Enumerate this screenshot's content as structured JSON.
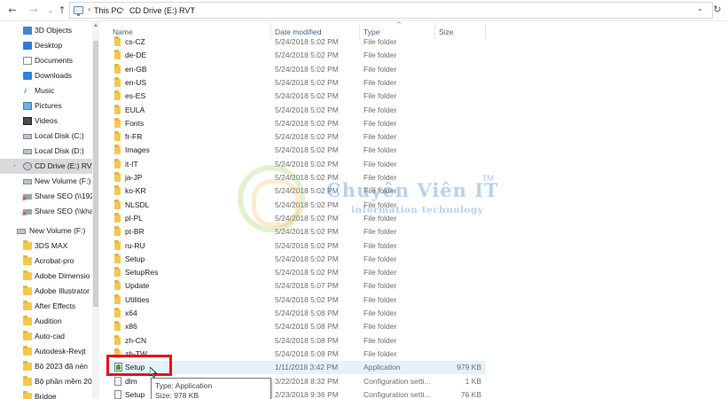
{
  "addressbar": {
    "back_icon": "←",
    "forward_icon": "→",
    "history_icon": "⌄",
    "up_icon": "↑",
    "crumbs": [
      "This PC",
      "CD Drive (E:) RVT"
    ],
    "sep_icon": "›",
    "dropdown_icon": "⌄",
    "refresh_icon": "↻"
  },
  "navpane": {
    "items": [
      {
        "label": "3D Objects",
        "icon": "3d-objects-icon"
      },
      {
        "label": "Desktop",
        "icon": "desktop-icon"
      },
      {
        "label": "Documents",
        "icon": "documents-icon"
      },
      {
        "label": "Downloads",
        "icon": "downloads-icon"
      },
      {
        "label": "Music",
        "icon": "music-icon"
      },
      {
        "label": "Pictures",
        "icon": "pictures-icon"
      },
      {
        "label": "Videos",
        "icon": "videos-icon"
      },
      {
        "label": "Local Disk (C:)",
        "icon": "drive-icon"
      },
      {
        "label": "Local Disk (D:)",
        "icon": "drive-icon"
      },
      {
        "label": "CD Drive (E:) RVT",
        "icon": "cd-drive-icon"
      },
      {
        "label": "New Volume (F:)",
        "icon": "drive-icon"
      },
      {
        "label": "Share SEO (\\\\192",
        "icon": "network-drive-icon"
      },
      {
        "label": "Share SEO (\\\\kha",
        "icon": "network-drive-icon"
      },
      {
        "label": "New Volume (F:)",
        "icon": "drive-icon"
      },
      {
        "label": "3DS MAX",
        "icon": "folder-icon"
      },
      {
        "label": "Acrobat-pro",
        "icon": "folder-icon"
      },
      {
        "label": "Adobe Dimensio",
        "icon": "folder-icon"
      },
      {
        "label": "Adobe Illustrator",
        "icon": "folder-icon"
      },
      {
        "label": "After Effects",
        "icon": "folder-icon"
      },
      {
        "label": "Audition",
        "icon": "folder-icon"
      },
      {
        "label": "Auto-cad",
        "icon": "folder-icon"
      },
      {
        "label": "Autodesk-Revjt",
        "icon": "folder-icon"
      },
      {
        "label": "Bộ 2023 đã nén",
        "icon": "folder-icon"
      },
      {
        "label": "Bộ phần mềm 20",
        "icon": "folder-icon"
      },
      {
        "label": "Bridge",
        "icon": "folder-icon"
      }
    ],
    "scroll_up_icon": "▲",
    "expand_icon": "›"
  },
  "columns": {
    "name": "Name",
    "date": "Date modified",
    "type": "Type",
    "size": "Size",
    "sort_icon": "^"
  },
  "files": [
    {
      "name": "cs-CZ",
      "date": "5/24/2018 5:02 PM",
      "type": "File folder",
      "size": "",
      "kind": "folder"
    },
    {
      "name": "de-DE",
      "date": "5/24/2018 5:02 PM",
      "type": "File folder",
      "size": "",
      "kind": "folder"
    },
    {
      "name": "en-GB",
      "date": "5/24/2018 5:02 PM",
      "type": "File folder",
      "size": "",
      "kind": "folder"
    },
    {
      "name": "en-US",
      "date": "5/24/2018 5:02 PM",
      "type": "File folder",
      "size": "",
      "kind": "folder"
    },
    {
      "name": "es-ES",
      "date": "5/24/2018 5:02 PM",
      "type": "File folder",
      "size": "",
      "kind": "folder"
    },
    {
      "name": "EULA",
      "date": "5/24/2018 5:02 PM",
      "type": "File folder",
      "size": "",
      "kind": "folder"
    },
    {
      "name": "Fonts",
      "date": "5/24/2018 5:02 PM",
      "type": "File folder",
      "size": "",
      "kind": "folder"
    },
    {
      "name": "fr-FR",
      "date": "5/24/2018 5:02 PM",
      "type": "File folder",
      "size": "",
      "kind": "folder"
    },
    {
      "name": "Images",
      "date": "5/24/2018 5:02 PM",
      "type": "File folder",
      "size": "",
      "kind": "folder"
    },
    {
      "name": "it-IT",
      "date": "5/24/2018 5:02 PM",
      "type": "File folder",
      "size": "",
      "kind": "folder"
    },
    {
      "name": "ja-JP",
      "date": "5/24/2018 5:02 PM",
      "type": "File folder",
      "size": "",
      "kind": "folder"
    },
    {
      "name": "ko-KR",
      "date": "5/24/2018 5:02 PM",
      "type": "File folder",
      "size": "",
      "kind": "folder"
    },
    {
      "name": "NLSDL",
      "date": "5/24/2018 5:02 PM",
      "type": "File folder",
      "size": "",
      "kind": "folder"
    },
    {
      "name": "pl-PL",
      "date": "5/24/2018 5:02 PM",
      "type": "File folder",
      "size": "",
      "kind": "folder"
    },
    {
      "name": "pt-BR",
      "date": "5/24/2018 5:02 PM",
      "type": "File folder",
      "size": "",
      "kind": "folder"
    },
    {
      "name": "ru-RU",
      "date": "5/24/2018 5:02 PM",
      "type": "File folder",
      "size": "",
      "kind": "folder"
    },
    {
      "name": "Setup",
      "date": "5/24/2018 5:02 PM",
      "type": "File folder",
      "size": "",
      "kind": "folder"
    },
    {
      "name": "SetupRes",
      "date": "5/24/2018 5:02 PM",
      "type": "File folder",
      "size": "",
      "kind": "folder"
    },
    {
      "name": "Update",
      "date": "5/24/2018 5:07 PM",
      "type": "File folder",
      "size": "",
      "kind": "folder"
    },
    {
      "name": "Utilities",
      "date": "5/24/2018 5:02 PM",
      "type": "File folder",
      "size": "",
      "kind": "folder"
    },
    {
      "name": "x64",
      "date": "5/24/2018 5:08 PM",
      "type": "File folder",
      "size": "",
      "kind": "folder"
    },
    {
      "name": "x86",
      "date": "5/24/2018 5:08 PM",
      "type": "File folder",
      "size": "",
      "kind": "folder"
    },
    {
      "name": "zh-CN",
      "date": "5/24/2018 5:08 PM",
      "type": "File folder",
      "size": "",
      "kind": "folder"
    },
    {
      "name": "zh-TW",
      "date": "5/24/2018 5:08 PM",
      "type": "File folder",
      "size": "",
      "kind": "folder"
    },
    {
      "name": "Setup",
      "date": "1/11/2018 3:42 PM",
      "type": "Application",
      "size": "979 KB",
      "kind": "app"
    },
    {
      "name": "dlm",
      "date": "3/22/2018 8:32 PM",
      "type": "Configuration setti...",
      "size": "1 KB",
      "kind": "config"
    },
    {
      "name": "Setup",
      "date": "2/23/2018 9:36 PM",
      "type": "Configuration setti...",
      "size": "76 KB",
      "kind": "config"
    }
  ],
  "tooltip": {
    "type_line": "Type: Application",
    "size_line": "Size: 978 KB"
  },
  "watermark": {
    "title": "Chuyên Viên IT",
    "tm": "TM",
    "subtitle": "information technology"
  },
  "colors": {
    "selected_bg": "#d9d9d9",
    "hover_bg": "#e5f1fb",
    "highlight_box": "#e3151a",
    "folder": "#f6c84a"
  }
}
